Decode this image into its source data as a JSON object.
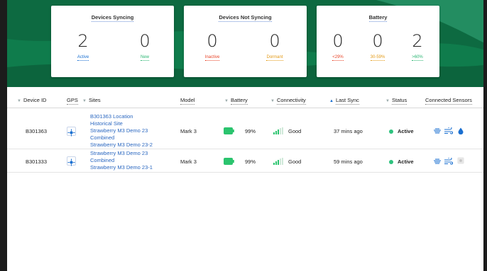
{
  "summary": {
    "syncing": {
      "title": "Devices Syncing",
      "metrics": [
        {
          "value": "2",
          "label": "Active"
        },
        {
          "value": "0",
          "label": "New"
        }
      ]
    },
    "not_syncing": {
      "title": "Devices Not Syncing",
      "metrics": [
        {
          "value": "0",
          "label": "Inactive"
        },
        {
          "value": "0",
          "label": "Dormant"
        }
      ]
    },
    "battery": {
      "title": "Battery",
      "metrics": [
        {
          "value": "0",
          "label": "<29%"
        },
        {
          "value": "0",
          "label": "30-59%"
        },
        {
          "value": "2",
          "label": ">60%"
        }
      ]
    }
  },
  "table": {
    "headers": {
      "device_id": "Device ID",
      "gps": "GPS",
      "sites": "Sites",
      "model": "Model",
      "battery": "Battery",
      "connectivity": "Connectivity",
      "last_sync": "Last Sync",
      "status": "Status",
      "connected_sensors": "Connected Sensors"
    },
    "rows": [
      {
        "device_id": "B301363",
        "sites": [
          "B301363 Location",
          "Historical Site",
          "Strawberry M3 Demo 23",
          "Combined",
          "Strawberry M3 Demo 23-2"
        ],
        "model": "Mark 3",
        "battery": "99%",
        "connectivity": "Good",
        "last_sync": "37 mins ago",
        "status": "Active"
      },
      {
        "device_id": "B301333",
        "sites": [
          "Strawberry M3 Demo 23",
          "Combined",
          "Strawberry M3 Demo 23-1"
        ],
        "model": "Mark 3",
        "battery": "99%",
        "connectivity": "Good",
        "last_sync": "59 mins ago",
        "status": "Active"
      }
    ]
  },
  "colors": {
    "active": "#1a6fd0",
    "new": "#2bb673",
    "inactive": "#e8462a",
    "dormant": "#e39a16",
    "low_battery": "#e8462a",
    "mid_battery": "#e39a16",
    "high_battery": "#2bb673",
    "header_green": "#0f6e45",
    "status_active": "#2ec27e",
    "link": "#2a67c0"
  },
  "icons": {
    "gps": "crosshair-icon",
    "battery": "battery-full-icon",
    "signal": "signal-bars-icon",
    "sensors": [
      "soil-sensor-icon",
      "wind-icon",
      "water-drop-icon",
      "sensor-off-icon"
    ]
  }
}
